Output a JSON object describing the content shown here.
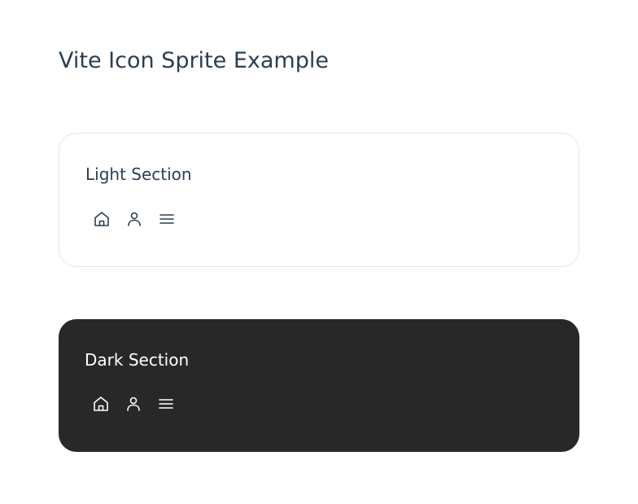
{
  "page": {
    "title": "Vite Icon Sprite Example"
  },
  "sections": [
    {
      "title": "Light Section",
      "theme": "light",
      "text_color": "#2c3e50",
      "background": "#ffffff",
      "icons": [
        "home-icon",
        "user-icon",
        "menu-icon"
      ]
    },
    {
      "title": "Dark Section",
      "theme": "dark",
      "text_color": "#ffffff",
      "background": "#282828",
      "icons": [
        "home-icon",
        "user-icon",
        "menu-icon"
      ]
    }
  ]
}
